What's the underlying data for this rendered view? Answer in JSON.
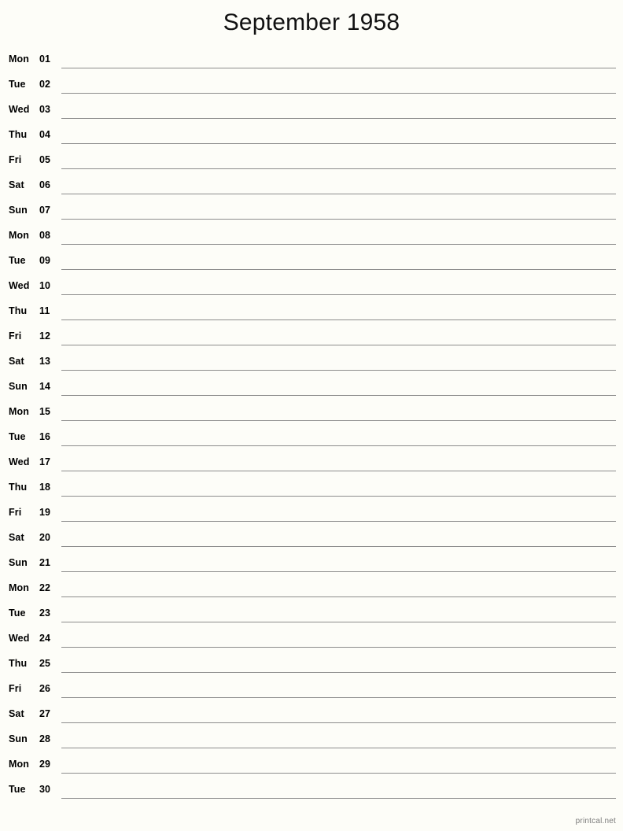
{
  "page": {
    "title": "September 1958",
    "month_name": "September",
    "year": "1958",
    "background_color": "#fdfdf8",
    "rule_color": "#8c8c8c",
    "text_color": "#000000"
  },
  "footer": {
    "credit": "printcal.net",
    "color": "#7b7b7b"
  },
  "calendar": {
    "days": [
      {
        "weekday": "Mon",
        "date": "01"
      },
      {
        "weekday": "Tue",
        "date": "02"
      },
      {
        "weekday": "Wed",
        "date": "03"
      },
      {
        "weekday": "Thu",
        "date": "04"
      },
      {
        "weekday": "Fri",
        "date": "05"
      },
      {
        "weekday": "Sat",
        "date": "06"
      },
      {
        "weekday": "Sun",
        "date": "07"
      },
      {
        "weekday": "Mon",
        "date": "08"
      },
      {
        "weekday": "Tue",
        "date": "09"
      },
      {
        "weekday": "Wed",
        "date": "10"
      },
      {
        "weekday": "Thu",
        "date": "11"
      },
      {
        "weekday": "Fri",
        "date": "12"
      },
      {
        "weekday": "Sat",
        "date": "13"
      },
      {
        "weekday": "Sun",
        "date": "14"
      },
      {
        "weekday": "Mon",
        "date": "15"
      },
      {
        "weekday": "Tue",
        "date": "16"
      },
      {
        "weekday": "Wed",
        "date": "17"
      },
      {
        "weekday": "Thu",
        "date": "18"
      },
      {
        "weekday": "Fri",
        "date": "19"
      },
      {
        "weekday": "Sat",
        "date": "20"
      },
      {
        "weekday": "Sun",
        "date": "21"
      },
      {
        "weekday": "Mon",
        "date": "22"
      },
      {
        "weekday": "Tue",
        "date": "23"
      },
      {
        "weekday": "Wed",
        "date": "24"
      },
      {
        "weekday": "Thu",
        "date": "25"
      },
      {
        "weekday": "Fri",
        "date": "26"
      },
      {
        "weekday": "Sat",
        "date": "27"
      },
      {
        "weekday": "Sun",
        "date": "28"
      },
      {
        "weekday": "Mon",
        "date": "29"
      },
      {
        "weekday": "Tue",
        "date": "30"
      }
    ]
  }
}
